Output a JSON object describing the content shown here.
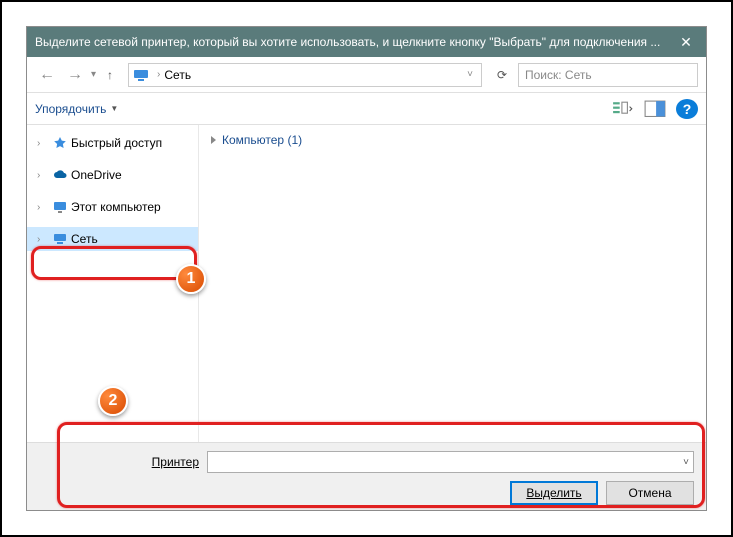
{
  "titlebar": {
    "text": "Выделите сетевой принтер, который вы хотите использовать, и щелкните кнопку \"Выбрать\" для подключения ...",
    "close": "✕"
  },
  "nav": {
    "back": "←",
    "forward": "→",
    "up": "↑",
    "address_label": "Сеть",
    "refresh_icon": "⟳",
    "search_placeholder": "Поиск: Сеть"
  },
  "toolbar": {
    "organize_label": "Упорядочить",
    "help_icon": "?"
  },
  "sidebar": {
    "items": [
      {
        "label": "Быстрый доступ",
        "icon": "star",
        "color": "#f0a020"
      },
      {
        "label": "OneDrive",
        "icon": "cloud",
        "color": "#0a64a4"
      },
      {
        "label": "Этот компьютер",
        "icon": "monitor",
        "color": "#3a8dde"
      },
      {
        "label": "Сеть",
        "icon": "network",
        "color": "#3a8dde"
      }
    ]
  },
  "content": {
    "group_header": "Компьютер (1)"
  },
  "bottom": {
    "printer_label": "Принтер",
    "select_button": "Выделить",
    "cancel_button": "Отмена"
  },
  "annotations": {
    "badge1": "1",
    "badge2": "2"
  }
}
